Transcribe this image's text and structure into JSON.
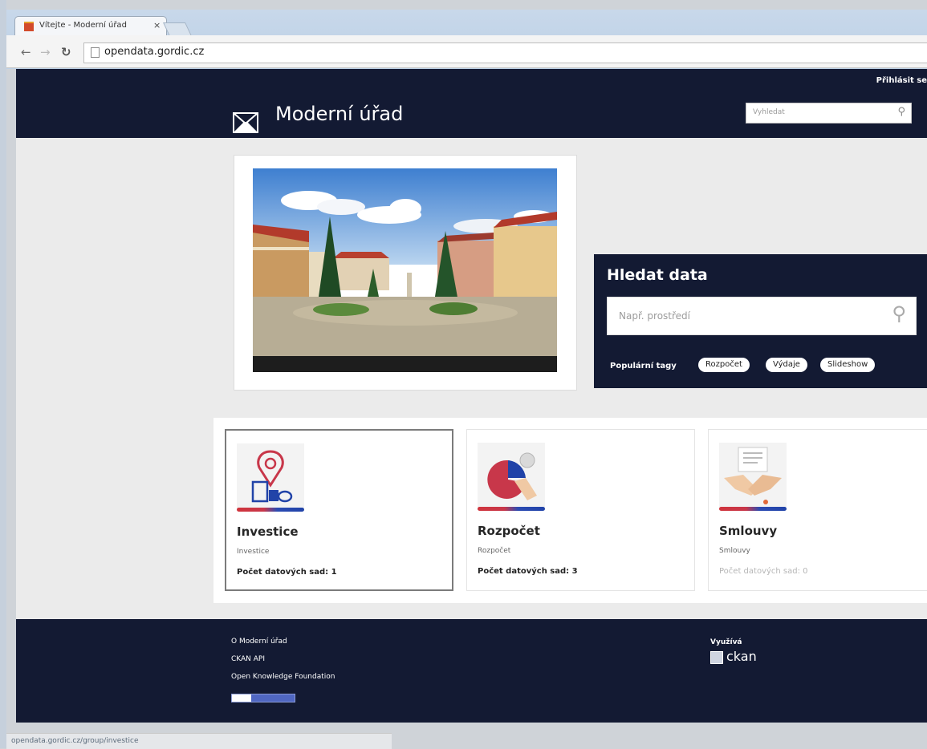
{
  "browser": {
    "tab_title": "Vítejte - Moderní úřad",
    "tab_close": "×",
    "url": "opendata.gordic.cz",
    "status_url": "opendata.gordic.cz/group/investice"
  },
  "header": {
    "login": "Přihlásit se",
    "brand": "Moderní úřad",
    "search_placeholder": "Vyhledat"
  },
  "search_panel": {
    "title": "Hledat data",
    "placeholder": "Např. prostředí",
    "tags_label": "Populární tagy",
    "tags": [
      "Rozpočet",
      "Výdaje",
      "Slideshow"
    ]
  },
  "groups": [
    {
      "title": "Investice",
      "subtitle": "Investice",
      "count": "Počet datových sad: 1",
      "icon": "location-pin-icon"
    },
    {
      "title": "Rozpočet",
      "subtitle": "Rozpočet",
      "count": "Počet datových sad: 3",
      "icon": "pie-chart-icon"
    },
    {
      "title": "Smlouvy",
      "subtitle": "Smlouvy",
      "count": "Počet datových sad: 0",
      "icon": "handshake-icon"
    }
  ],
  "footer": {
    "links": [
      "O Moderní úřad",
      "CKAN API",
      "Open Knowledge Foundation"
    ],
    "powered_by": "Využívá",
    "ckan": "ckan"
  },
  "colors": {
    "navy": "#131a33",
    "accent_red": "#d0343c",
    "accent_blue": "#2143a8"
  }
}
